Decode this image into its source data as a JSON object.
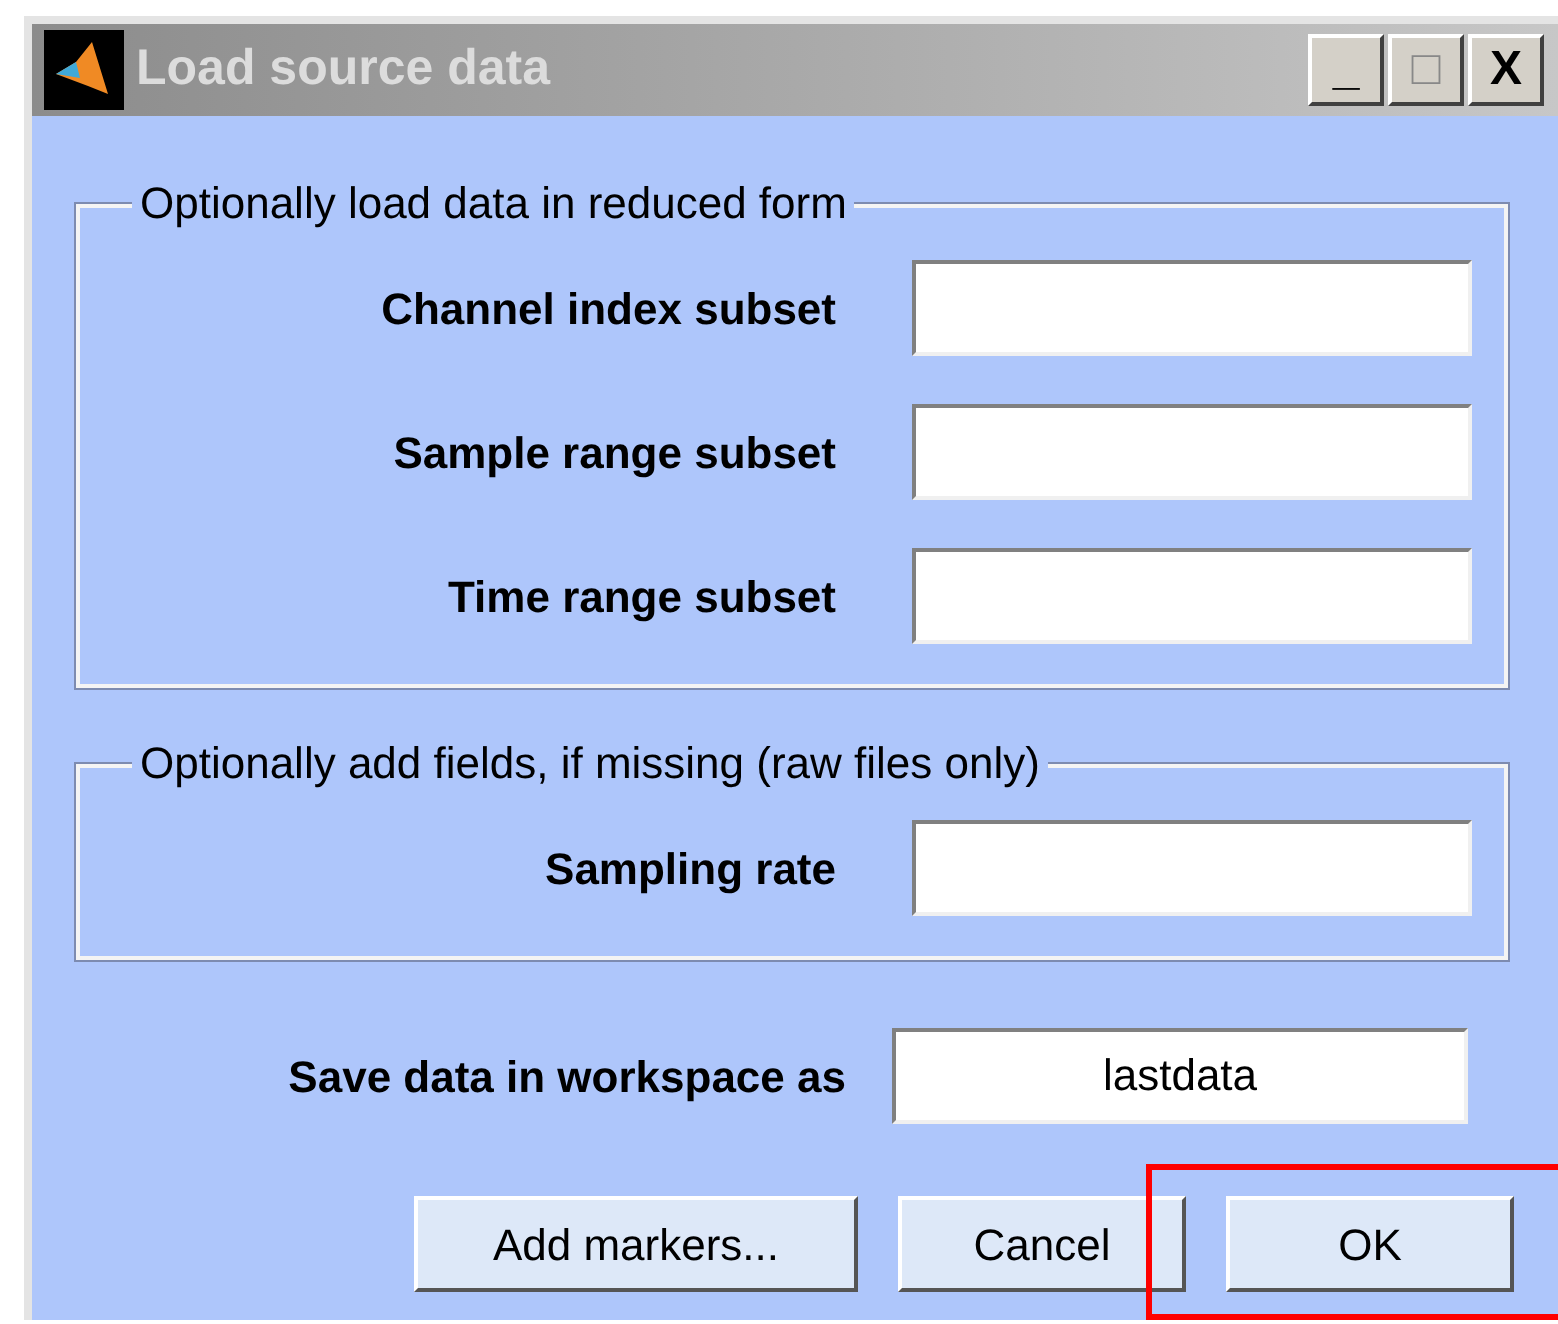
{
  "window": {
    "title": "Load source data",
    "controls": [
      "_",
      "□",
      "X"
    ]
  },
  "groups": [
    {
      "legend": "Optionally load data in reduced form",
      "fields": [
        {
          "label": "Channel index subset"
        },
        {
          "label": "Sample range subset"
        },
        {
          "label": "Time range subset"
        }
      ]
    },
    {
      "legend": "Optionally add fields, if missing (raw files only)",
      "fields": [
        {
          "label": "Sampling rate"
        }
      ]
    }
  ],
  "save": {
    "label": "Save data in workspace as",
    "value": "lastdata"
  },
  "buttons": [
    {
      "label": "Add markers...",
      "highlighted": false
    },
    {
      "label": "Cancel",
      "highlighted": false
    },
    {
      "label": "OK",
      "highlighted": true
    }
  ]
}
